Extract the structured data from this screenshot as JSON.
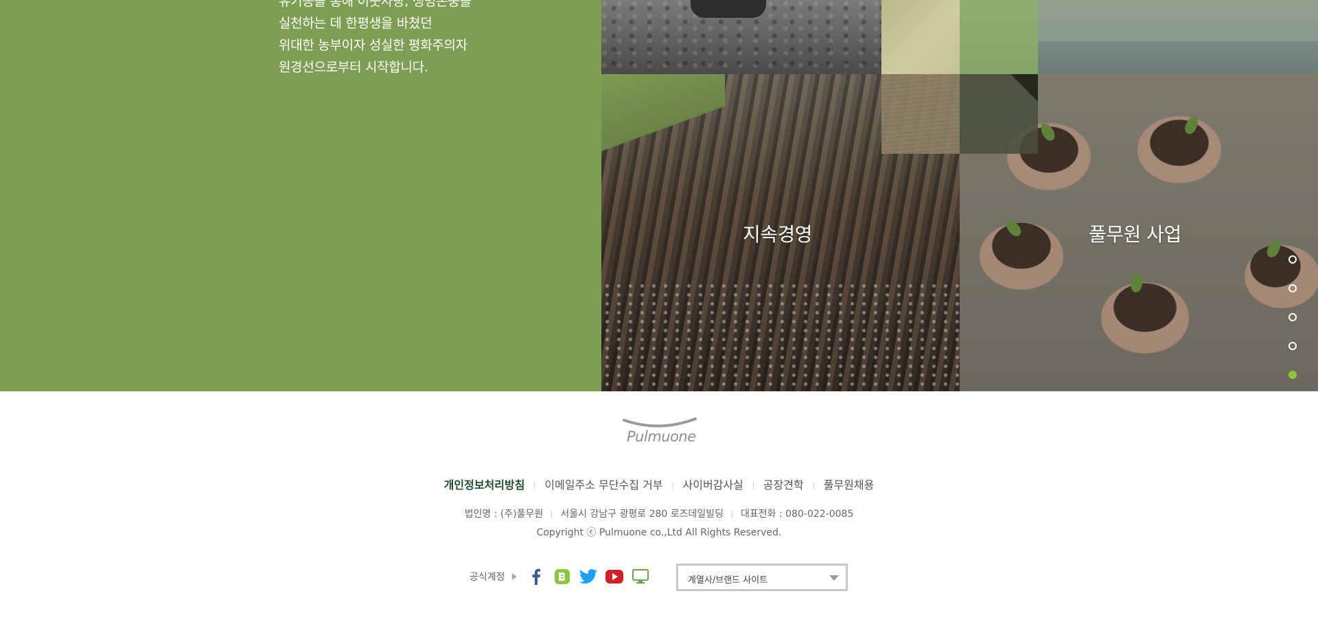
{
  "intro": {
    "lines": [
      "유기농을 통해 이웃사랑, 생명존중을",
      "실천하는 데 한평생을 바쳤던",
      "위대한 농부이자 성실한 평화주의자",
      "원경선으로부터 시작합니다."
    ]
  },
  "tiles": {
    "sustainability_label": "지속경영",
    "business_label": "풀무원 사업"
  },
  "pagination": {
    "count": 5,
    "active_index": 4,
    "active_color": "#8cc63f"
  },
  "footer": {
    "logo_text": "Pulmuone",
    "links": [
      {
        "label": "개인정보처리방침",
        "primary": true
      },
      {
        "label": "이메일주소 무단수집 거부",
        "primary": false
      },
      {
        "label": "사이버감사실",
        "primary": false
      },
      {
        "label": "공장견학",
        "primary": false
      },
      {
        "label": "풀무원채용",
        "primary": false
      }
    ],
    "company": "법인명 : (주)풀무원",
    "address": "서울시 강남구 광평로 280 로즈데일빌딩",
    "phone": "대표전화 : 080-022-0085",
    "copyright": "Copyright ⓒ Pulmuone co.,Ltd All Rights Reserved.",
    "official_accounts_label": "공식계정",
    "social_icons": [
      "facebook-icon",
      "blog-icon",
      "twitter-icon",
      "youtube-icon",
      "monitor-icon"
    ],
    "family_site_select": "계열사/브랜드 사이트"
  },
  "colors": {
    "brand_green": "#7d9e53",
    "footer_link_primary": "#1d4b2c"
  }
}
